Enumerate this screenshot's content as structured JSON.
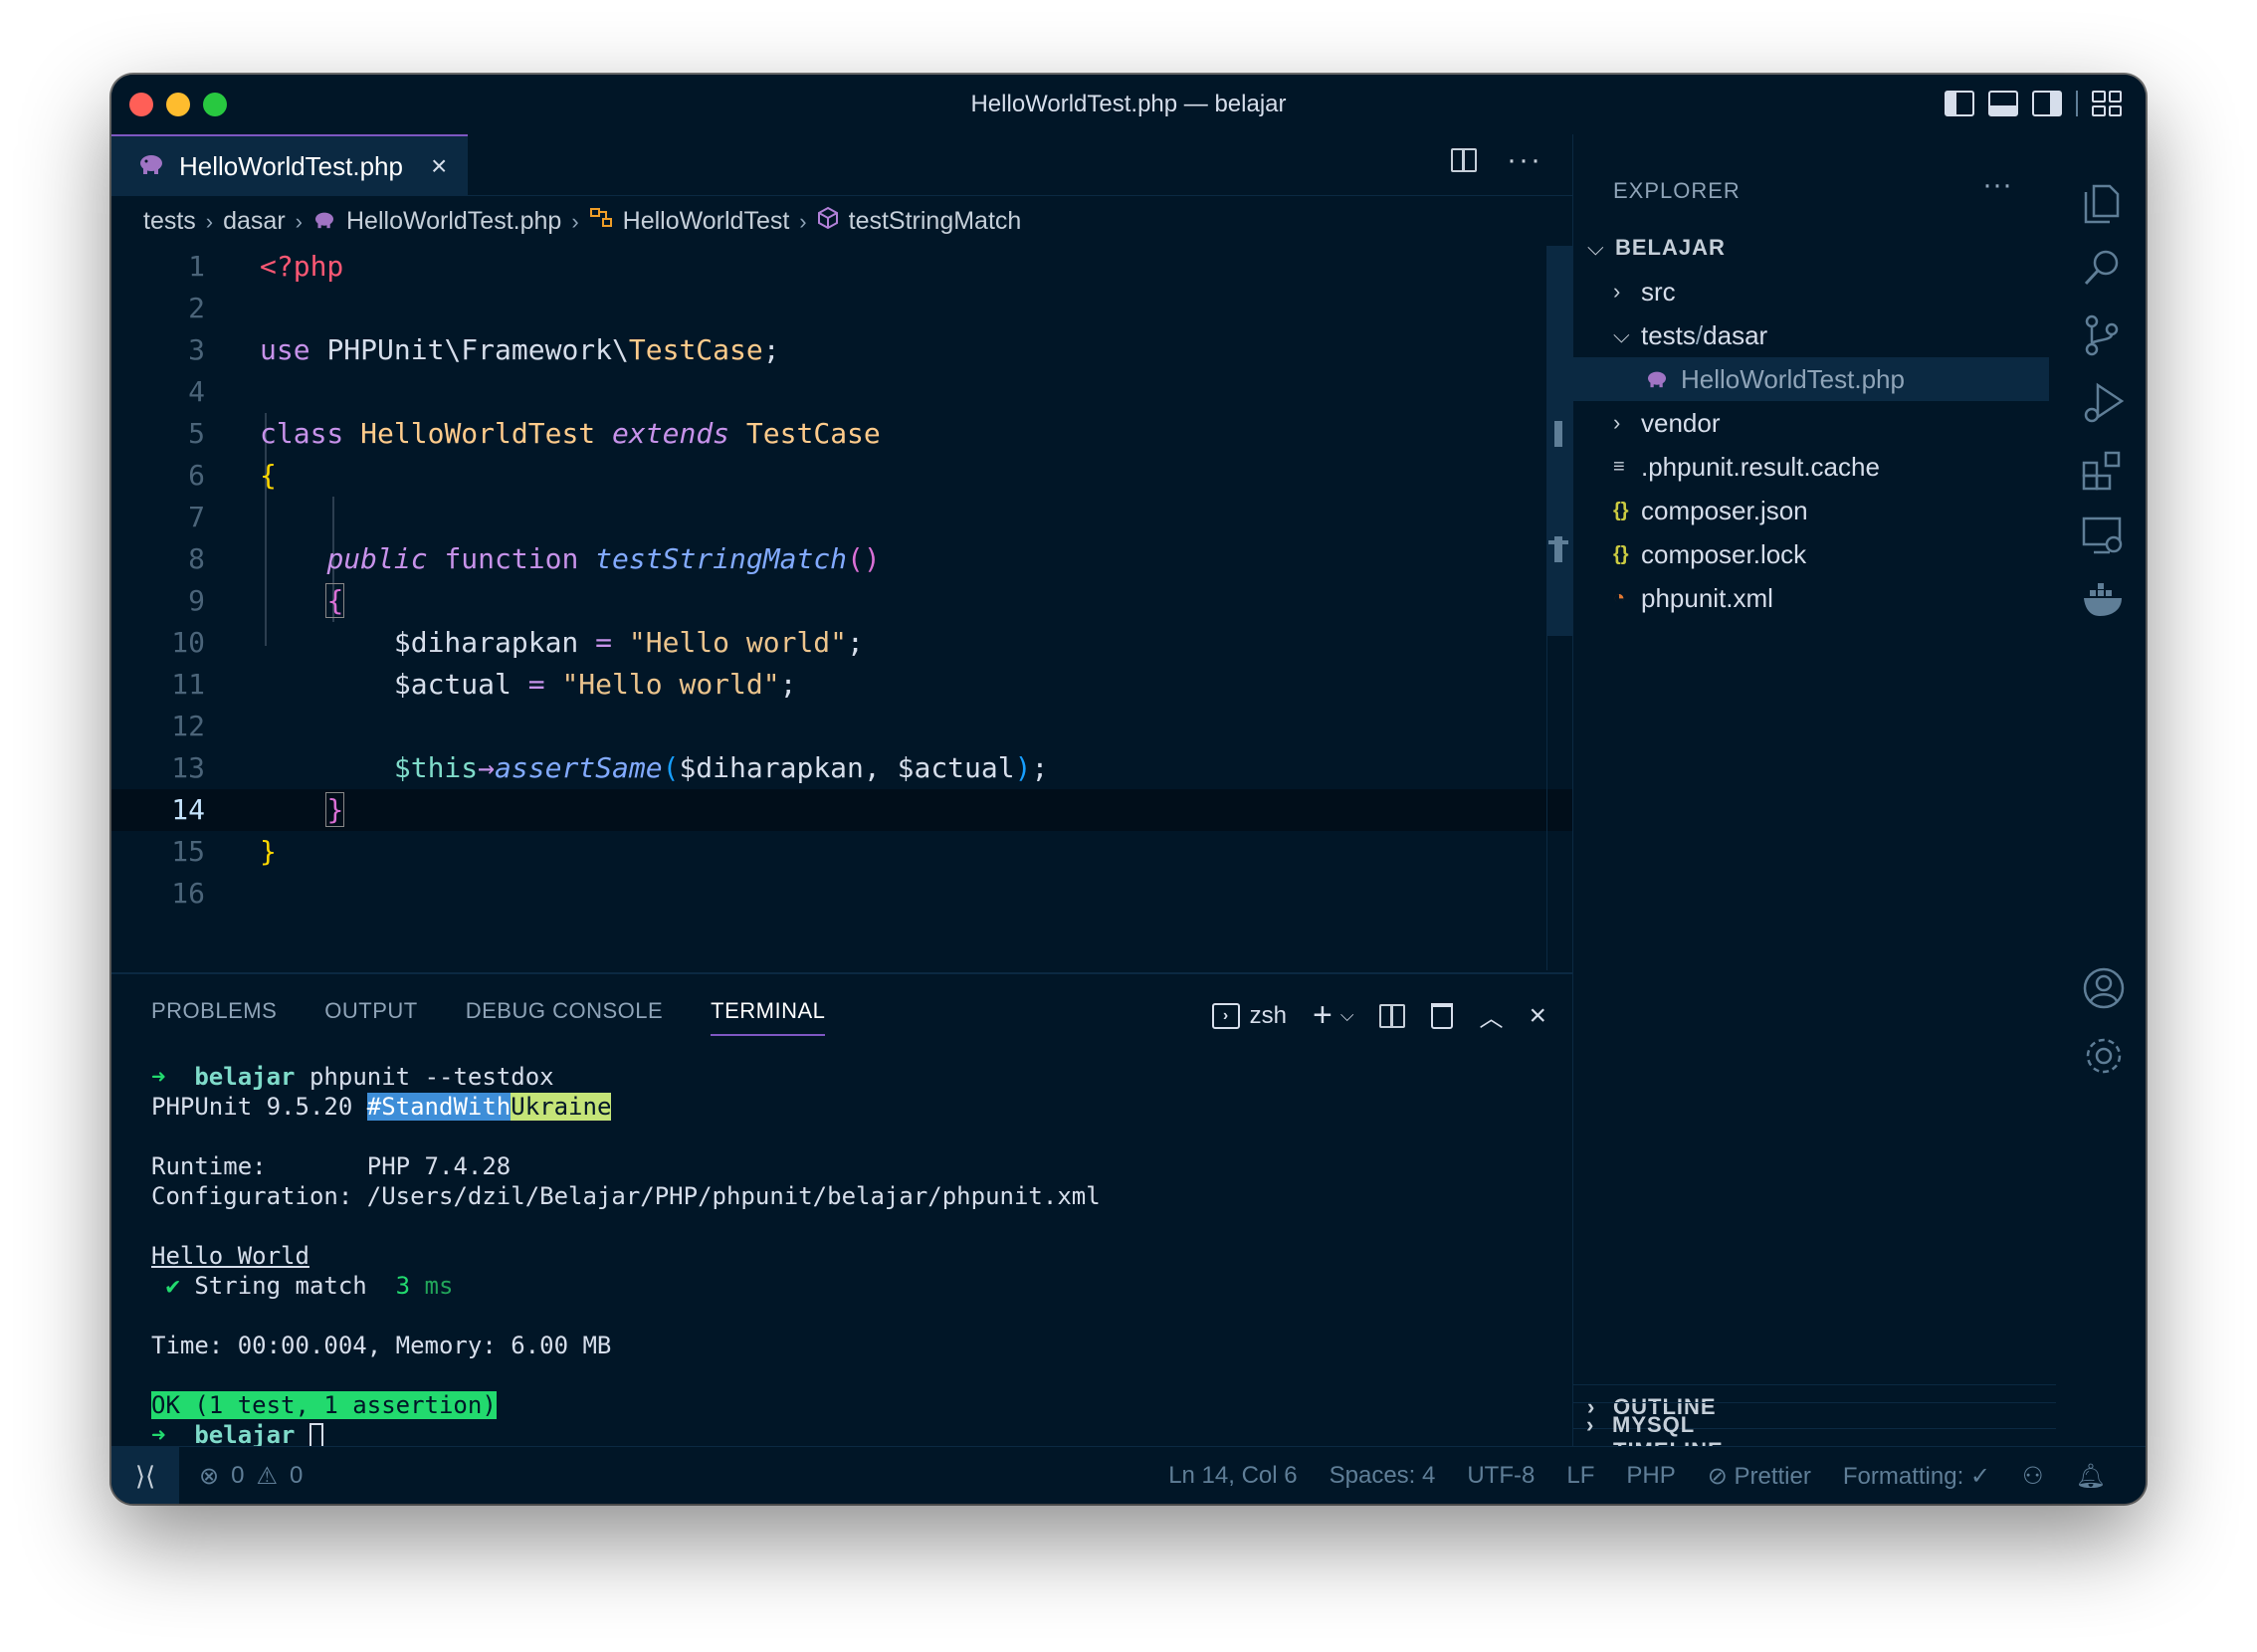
{
  "window": {
    "title": "HelloWorldTest.php — belajar"
  },
  "editor": {
    "tab": {
      "label": "HelloWorldTest.php",
      "close": "×"
    },
    "breadcrumb": [
      "tests",
      "dasar",
      "HelloWorldTest.php",
      "HelloWorldTest",
      "testStringMatch"
    ],
    "line_numbers": [
      "1",
      "2",
      "3",
      "4",
      "5",
      "6",
      "7",
      "8",
      "9",
      "10",
      "11",
      "12",
      "13",
      "14",
      "15",
      "16"
    ],
    "code": {
      "l1": "<?php",
      "l3a": "use ",
      "l3b": "PHPUnit\\Framework\\",
      "l3c": "TestCase",
      "l3d": ";",
      "l5a": "class ",
      "l5b": "HelloWorldTest",
      "l5c": "extends",
      "l5d": "TestCase",
      "l6": "{",
      "l8a": "public",
      "l8b": "function",
      "l8c": "testStringMatch",
      "l8d": "()",
      "l9": "{",
      "l10a": "$diharapkan",
      "l10b": " = ",
      "l10c": "\"Hello world\"",
      "l10d": ";",
      "l11a": "$actual",
      "l11b": " = ",
      "l11c": "\"Hello world\"",
      "l11d": ";",
      "l13a": "$this",
      "l13b": "→",
      "l13c": "assertSame",
      "l13d": "(",
      "l13e": "$diharapkan, $actual",
      "l13f": ")",
      "l13g": ";",
      "l14": "}",
      "l15": "}"
    }
  },
  "panel": {
    "tabs": [
      "PROBLEMS",
      "OUTPUT",
      "DEBUG CONSOLE",
      "TERMINAL"
    ],
    "shell": "zsh",
    "terminal": {
      "prompt_arrow": "➜",
      "prompt_dir": "belajar",
      "command": "phpunit --testdox",
      "version": "PHPUnit 9.5.20 ",
      "tag1": "#StandWith",
      "tag2": "Ukraine",
      "runtime_label": "Runtime:       ",
      "runtime": "PHP 7.4.28",
      "config_label": "Configuration: ",
      "config": "/Users/dzil/Belajar/PHP/phpunit/belajar/phpunit.xml",
      "suite": "Hello World",
      "check": " ✔",
      "test": " String match ",
      "time_val": " 3",
      "time_unit": " ms",
      "summary": "Time: 00:00.004, Memory: 6.00 MB",
      "ok": "OK (1 test, 1 assertion)"
    }
  },
  "sidebar": {
    "title": "EXPLORER",
    "dots": "···",
    "root": "BELAJAR",
    "items": {
      "src": "src",
      "tests": "tests",
      "tests_sep": " / ",
      "dasar": "dasar",
      "file_active": "HelloWorldTest.php",
      "vendor": "vendor",
      "cache": ".phpunit.result.cache",
      "composer_json": "composer.json",
      "composer_lock": "composer.lock",
      "phpunit_xml": "phpunit.xml"
    },
    "sections": [
      "OUTLINE",
      "TIMELINE",
      "MYSQL"
    ]
  },
  "statusbar": {
    "errors": "0",
    "warnings": "0",
    "position": "Ln 14, Col 6",
    "spaces": "Spaces: 4",
    "encoding": "UTF-8",
    "eol": "LF",
    "language": "PHP",
    "prettier": "Prettier",
    "formatting": "Formatting: ✓"
  },
  "colors": {
    "background": "#011627",
    "accent": "#7e57c2",
    "terminal_ok": "#22da6e"
  },
  "icons": [
    "files-icon",
    "search-icon",
    "source-control-icon",
    "run-debug-icon",
    "extensions-icon",
    "remote-explorer-icon",
    "docker-icon",
    "account-icon",
    "settings-gear-icon"
  ]
}
